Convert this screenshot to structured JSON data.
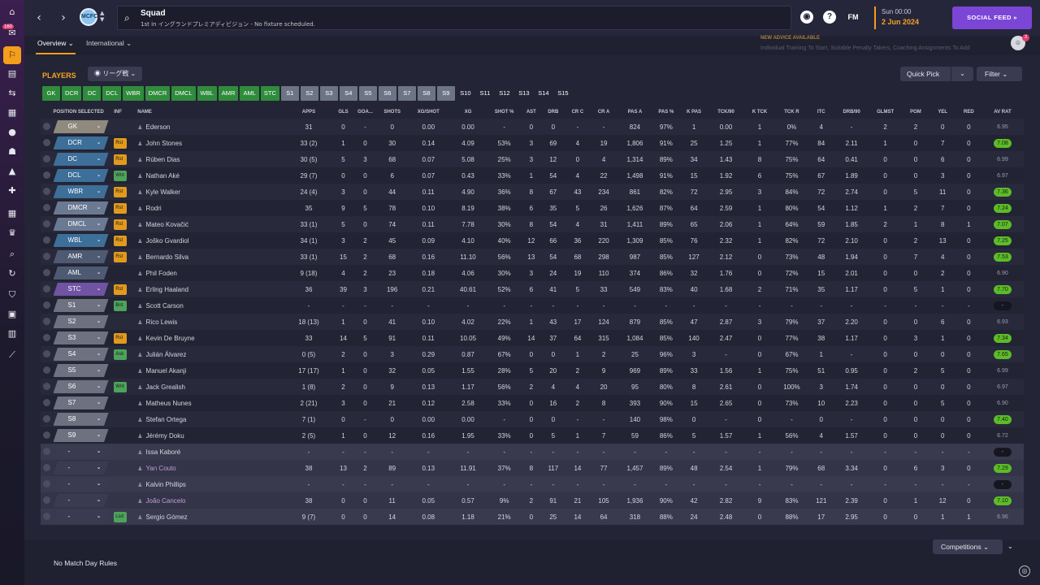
{
  "rail": {
    "badge": "160",
    "icons": [
      "home-icon",
      "inbox-icon",
      "squad-icon",
      "tactics-icon",
      "dynamics-icon",
      "transfers-icon",
      "data-hub-icon",
      "scouting-icon",
      "medical-icon",
      "training-icon",
      "schedule-icon",
      "competitions-icon",
      "search-icon",
      "transfer-swap-icon",
      "club-info-icon",
      "finances-icon",
      "staff-icon",
      "development-icon"
    ]
  },
  "topbar": {
    "title": "Squad",
    "subtitle": "1st in イングランドプレミアディビジョン - No fixture scheduled.",
    "date_time": "Sun 00:00",
    "date": "2 Jun 2024",
    "social_feed": "SOCIAL FEED",
    "fm": "FM",
    "crest": "MCFC"
  },
  "subbar": {
    "tabs": [
      "Overview",
      "International"
    ],
    "advice_title": "NEW ADVICE AVAILABLE",
    "advice_text": "Individual Training To Start, Suitable Penalty Takers, Coaching Assignments To Add",
    "advice_count": "3"
  },
  "toolbar": {
    "players_label": "PLAYERS",
    "view": "リーグ戦",
    "quick_pick": "Quick Pick",
    "filter": "Filter"
  },
  "chips": [
    "GK",
    "DCR",
    "DC",
    "DCL",
    "WBR",
    "DMCR",
    "DMCL",
    "WBL",
    "AMR",
    "AML",
    "STC",
    "S1",
    "S2",
    "S3",
    "S4",
    "S5",
    "S6",
    "S7",
    "S8",
    "S9",
    "S10",
    "S11",
    "S12",
    "S13",
    "S14",
    "S15"
  ],
  "columns": [
    "POSITION SELECTED",
    "INF",
    "NAME",
    "APPS",
    "GLS",
    "GOA...",
    "SHOTS",
    "XG/SHOT",
    "XG",
    "SHOT %",
    "AST",
    "DRB",
    "CR C",
    "CR A",
    "PAS A",
    "PAS %",
    "K PAS",
    "TCK/90",
    "K TCK",
    "TCK R",
    "ITC",
    "DRB/90",
    "GLMST",
    "POM",
    "YEL",
    "RED",
    "AV RAT"
  ],
  "rows": [
    {
      "pos": "GK",
      "inf": "",
      "name": "Ederson",
      "s": [
        "31",
        "0",
        "-",
        "0",
        "0.00",
        "0.00",
        "-",
        "0",
        "0",
        "-",
        "-",
        "824",
        "97%",
        "1",
        "0.00",
        "1",
        "0%",
        "4",
        "-",
        "2",
        "2",
        "0",
        "0"
      ],
      "rat": "6.95"
    },
    {
      "pos": "DCR",
      "inf": "Rst",
      "name": "John Stones",
      "s": [
        "33 (2)",
        "1",
        "0",
        "30",
        "0.14",
        "4.09",
        "53%",
        "3",
        "69",
        "4",
        "19",
        "1,806",
        "91%",
        "25",
        "1.25",
        "1",
        "77%",
        "84",
        "2.11",
        "1",
        "0",
        "7",
        "0"
      ],
      "rat": "7.08"
    },
    {
      "pos": "DC",
      "inf": "Rst",
      "name": "Rúben Dias",
      "s": [
        "30 (5)",
        "5",
        "3",
        "68",
        "0.07",
        "5.08",
        "25%",
        "3",
        "12",
        "0",
        "4",
        "1,314",
        "89%",
        "34",
        "1.43",
        "8",
        "75%",
        "64",
        "0.41",
        "0",
        "0",
        "6",
        "0"
      ],
      "rat": "6.99"
    },
    {
      "pos": "DCL",
      "inf": "Wnt",
      "name": "Nathan Aké",
      "s": [
        "29 (7)",
        "0",
        "0",
        "6",
        "0.07",
        "0.43",
        "33%",
        "1",
        "54",
        "4",
        "22",
        "1,498",
        "91%",
        "15",
        "1.92",
        "6",
        "75%",
        "67",
        "1.89",
        "0",
        "0",
        "3",
        "0"
      ],
      "rat": "6.97"
    },
    {
      "pos": "WBR",
      "inf": "Rst",
      "name": "Kyle Walker",
      "s": [
        "24 (4)",
        "3",
        "0",
        "44",
        "0.11",
        "4.90",
        "36%",
        "8",
        "67",
        "43",
        "234",
        "861",
        "82%",
        "72",
        "2.95",
        "3",
        "84%",
        "72",
        "2.74",
        "0",
        "5",
        "11",
        "0"
      ],
      "rat": "7.36"
    },
    {
      "pos": "DMCR",
      "inf": "Rst",
      "name": "Rodri",
      "s": [
        "35",
        "9",
        "5",
        "78",
        "0.10",
        "8.19",
        "38%",
        "6",
        "35",
        "5",
        "26",
        "1,626",
        "87%",
        "64",
        "2.59",
        "1",
        "80%",
        "54",
        "1.12",
        "1",
        "2",
        "7",
        "0"
      ],
      "rat": "7.24"
    },
    {
      "pos": "DMCL",
      "inf": "Rst",
      "name": "Mateo Kovačić",
      "s": [
        "33 (1)",
        "5",
        "0",
        "74",
        "0.11",
        "7.78",
        "30%",
        "8",
        "54",
        "4",
        "31",
        "1,411",
        "89%",
        "65",
        "2.06",
        "1",
        "64%",
        "59",
        "1.85",
        "2",
        "1",
        "8",
        "1"
      ],
      "rat": "7.07"
    },
    {
      "pos": "WBL",
      "inf": "Rst",
      "name": "Joško Gvardiol",
      "s": [
        "34 (1)",
        "3",
        "2",
        "45",
        "0.09",
        "4.10",
        "40%",
        "12",
        "66",
        "36",
        "220",
        "1,309",
        "85%",
        "76",
        "2.32",
        "1",
        "82%",
        "72",
        "2.10",
        "0",
        "2",
        "13",
        "0"
      ],
      "rat": "7.25"
    },
    {
      "pos": "AMR",
      "inf": "Rst",
      "name": "Bernardo Silva",
      "s": [
        "33 (1)",
        "15",
        "2",
        "68",
        "0.16",
        "11.10",
        "56%",
        "13",
        "54",
        "68",
        "298",
        "987",
        "85%",
        "127",
        "2.12",
        "0",
        "73%",
        "48",
        "1.94",
        "0",
        "7",
        "4",
        "0"
      ],
      "rat": "7.53"
    },
    {
      "pos": "AML",
      "inf": "",
      "name": "Phil Foden",
      "s": [
        "9 (18)",
        "4",
        "2",
        "23",
        "0.18",
        "4.06",
        "30%",
        "3",
        "24",
        "19",
        "110",
        "374",
        "86%",
        "32",
        "1.76",
        "0",
        "72%",
        "15",
        "2.01",
        "0",
        "0",
        "2",
        "0"
      ],
      "rat": "6.90"
    },
    {
      "pos": "STC",
      "inf": "Rst",
      "name": "Erling Haaland",
      "s": [
        "36",
        "39",
        "3",
        "196",
        "0.21",
        "40.61",
        "52%",
        "6",
        "41",
        "5",
        "33",
        "549",
        "83%",
        "40",
        "1.68",
        "2",
        "71%",
        "35",
        "1.17",
        "0",
        "5",
        "1",
        "0"
      ],
      "rat": "7.70"
    },
    {
      "pos": "S1",
      "inf": "Bnt",
      "name": "Scott Carson",
      "s": [
        "-",
        "-",
        "-",
        "-",
        "-",
        "-",
        "-",
        "-",
        "-",
        "-",
        "-",
        "-",
        "-",
        "-",
        "-",
        "-",
        "-",
        "-",
        "-",
        "-",
        "-",
        "-",
        "-"
      ],
      "rat": "-"
    },
    {
      "pos": "S2",
      "inf": "",
      "name": "Rico Lewis",
      "s": [
        "18 (13)",
        "1",
        "0",
        "41",
        "0.10",
        "4.02",
        "22%",
        "1",
        "43",
        "17",
        "124",
        "879",
        "85%",
        "47",
        "2.87",
        "3",
        "79%",
        "37",
        "2.20",
        "0",
        "0",
        "6",
        "0"
      ],
      "rat": "6.93"
    },
    {
      "pos": "S3",
      "inf": "Rst",
      "name": "Kevin De Bruyne",
      "s": [
        "33",
        "14",
        "5",
        "91",
        "0.11",
        "10.05",
        "49%",
        "14",
        "37",
        "64",
        "315",
        "1,084",
        "85%",
        "140",
        "2.47",
        "0",
        "77%",
        "38",
        "1.17",
        "0",
        "3",
        "1",
        "0"
      ],
      "rat": "7.34"
    },
    {
      "pos": "S4",
      "inf": "Ask",
      "name": "Julián Álvarez",
      "s": [
        "0 (5)",
        "2",
        "0",
        "3",
        "0.29",
        "0.87",
        "67%",
        "0",
        "0",
        "1",
        "2",
        "25",
        "96%",
        "3",
        "-",
        "0",
        "67%",
        "1",
        "-",
        "0",
        "0",
        "0",
        "0"
      ],
      "rat": "7.65"
    },
    {
      "pos": "S5",
      "inf": "",
      "name": "Manuel Akanji",
      "s": [
        "17 (17)",
        "1",
        "0",
        "32",
        "0.05",
        "1.55",
        "28%",
        "5",
        "20",
        "2",
        "9",
        "969",
        "89%",
        "33",
        "1.56",
        "1",
        "75%",
        "51",
        "0.95",
        "0",
        "2",
        "5",
        "0"
      ],
      "rat": "6.99"
    },
    {
      "pos": "S6",
      "inf": "Wnt",
      "name": "Jack Grealish",
      "s": [
        "1 (8)",
        "2",
        "0",
        "9",
        "0.13",
        "1.17",
        "56%",
        "2",
        "4",
        "4",
        "20",
        "95",
        "80%",
        "8",
        "2.61",
        "0",
        "100%",
        "3",
        "1.74",
        "0",
        "0",
        "0",
        "0"
      ],
      "rat": "6.97"
    },
    {
      "pos": "S7",
      "inf": "",
      "name": "Matheus Nunes",
      "s": [
        "2 (21)",
        "3",
        "0",
        "21",
        "0.12",
        "2.58",
        "33%",
        "0",
        "16",
        "2",
        "8",
        "393",
        "90%",
        "15",
        "2.65",
        "0",
        "73%",
        "10",
        "2.23",
        "0",
        "0",
        "5",
        "0"
      ],
      "rat": "6.90"
    },
    {
      "pos": "S8",
      "inf": "",
      "name": "Stefan Ortega",
      "s": [
        "7 (1)",
        "0",
        "-",
        "0",
        "0.00",
        "0.00",
        "-",
        "0",
        "0",
        "-",
        "-",
        "140",
        "98%",
        "0",
        "-",
        "0",
        "-",
        "0",
        "-",
        "0",
        "0",
        "0",
        "0"
      ],
      "rat": "7.40"
    },
    {
      "pos": "S9",
      "inf": "",
      "name": "Jérémy Doku",
      "s": [
        "2 (5)",
        "1",
        "0",
        "12",
        "0.16",
        "1.95",
        "33%",
        "0",
        "5",
        "1",
        "7",
        "59",
        "86%",
        "5",
        "1.57",
        "1",
        "56%",
        "4",
        "1.57",
        "0",
        "0",
        "0",
        "0"
      ],
      "rat": "6.72"
    },
    {
      "pos": "-",
      "inf": "",
      "name": "Issa Kaboré",
      "s": [
        "-",
        "-",
        "-",
        "-",
        "-",
        "-",
        "-",
        "-",
        "-",
        "-",
        "-",
        "-",
        "-",
        "-",
        "-",
        "-",
        "-",
        "-",
        "-",
        "-",
        "-",
        "-",
        "-"
      ],
      "rat": "-"
    },
    {
      "pos": "-",
      "inf": "",
      "name": "Yan Couto",
      "s": [
        "38",
        "13",
        "2",
        "89",
        "0.13",
        "11.91",
        "37%",
        "8",
        "117",
        "14",
        "77",
        "1,457",
        "89%",
        "48",
        "2.54",
        "1",
        "79%",
        "68",
        "3.34",
        "0",
        "6",
        "3",
        "0"
      ],
      "rat": "7.29"
    },
    {
      "pos": "-",
      "inf": "",
      "name": "Kalvin Phillips",
      "s": [
        "-",
        "-",
        "-",
        "-",
        "-",
        "-",
        "-",
        "-",
        "-",
        "-",
        "-",
        "-",
        "-",
        "-",
        "-",
        "-",
        "-",
        "-",
        "-",
        "-",
        "-",
        "-",
        "-"
      ],
      "rat": "-"
    },
    {
      "pos": "-",
      "inf": "",
      "name": "João Cancelo",
      "s": [
        "38",
        "0",
        "0",
        "11",
        "0.05",
        "0.57",
        "9%",
        "2",
        "91",
        "21",
        "105",
        "1,936",
        "90%",
        "42",
        "2.82",
        "9",
        "83%",
        "121",
        "2.39",
        "0",
        "1",
        "12",
        "0"
      ],
      "rat": "7.10"
    },
    {
      "pos": "-",
      "inf": "Lsd",
      "name": "Sergio Gómez",
      "s": [
        "9 (7)",
        "0",
        "0",
        "14",
        "0.08",
        "1.18",
        "21%",
        "0",
        "25",
        "14",
        "64",
        "318",
        "88%",
        "24",
        "2.48",
        "0",
        "88%",
        "17",
        "2.95",
        "0",
        "0",
        "1",
        "1"
      ],
      "rat": "6.96"
    }
  ],
  "bottom": {
    "no_match_day": "No Match Day Rules",
    "competitions": "Competitions"
  },
  "colors": {
    "accent": "#f59e1b",
    "social": "#7b45d6",
    "chip_green": "#2f8c3c",
    "chip_grey": "#6d7585",
    "rating_green": "#5dbb2a",
    "pos_gk": "#8f8a7d",
    "pos_def": "#3d6f99",
    "pos_dm": "#6b7a93",
    "pos_mid": "#4e5a72",
    "pos_att": "#7054a3",
    "pos_sub": "#6e7180",
    "pos_none": "#3a3b50"
  }
}
